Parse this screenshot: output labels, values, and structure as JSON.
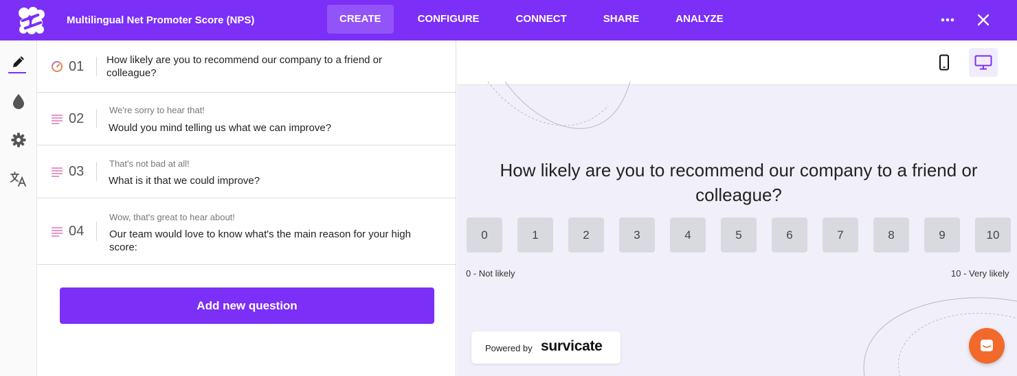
{
  "header": {
    "title": "Multilingual Net Promoter Score (NPS)",
    "tabs": [
      {
        "label": "CREATE",
        "active": true
      },
      {
        "label": "CONFIGURE",
        "active": false
      },
      {
        "label": "CONNECT",
        "active": false
      },
      {
        "label": "SHARE",
        "active": false
      },
      {
        "label": "ANALYZE",
        "active": false
      }
    ],
    "more_icon": "more-horizontal-icon",
    "close_icon": "close-icon"
  },
  "sidebar": {
    "items": [
      {
        "icon": "pencil-icon",
        "active": true
      },
      {
        "icon": "drop-icon",
        "active": false
      },
      {
        "icon": "gear-icon",
        "active": false
      },
      {
        "icon": "translate-icon",
        "active": false
      }
    ]
  },
  "questions": [
    {
      "number": "01",
      "icon": "nps-gauge-icon",
      "subtitle": "",
      "text": "How likely are you to recommend our company to a friend or colleague?"
    },
    {
      "number": "02",
      "icon": "text-lines-icon",
      "subtitle": "We're sorry to hear that!",
      "text": "Would you mind telling us what we can improve?"
    },
    {
      "number": "03",
      "icon": "text-lines-icon",
      "subtitle": "That's not bad at all!",
      "text": "What is it that we could improve?"
    },
    {
      "number": "04",
      "icon": "text-lines-icon",
      "subtitle": "Wow, that's great to hear about!",
      "text": "Our team would love to know what's the main reason for your high score:"
    }
  ],
  "add_question_label": "Add new question",
  "preview": {
    "question": "How likely are you to recommend our company to a friend or colleague?",
    "scale": [
      "0",
      "1",
      "2",
      "3",
      "4",
      "5",
      "6",
      "7",
      "8",
      "9",
      "10"
    ],
    "low_label": "0 - Not likely",
    "high_label": "10 - Very likely",
    "powered_by": "Powered by",
    "brand": "survicate",
    "devices": [
      {
        "icon": "mobile-icon",
        "active": false
      },
      {
        "icon": "desktop-icon",
        "active": true
      }
    ]
  },
  "colors": {
    "accent": "#7b2ff7",
    "chat": "#f26a2b",
    "preview_bg": "#f1f0fa",
    "scale_button": "#d9d9e0"
  }
}
